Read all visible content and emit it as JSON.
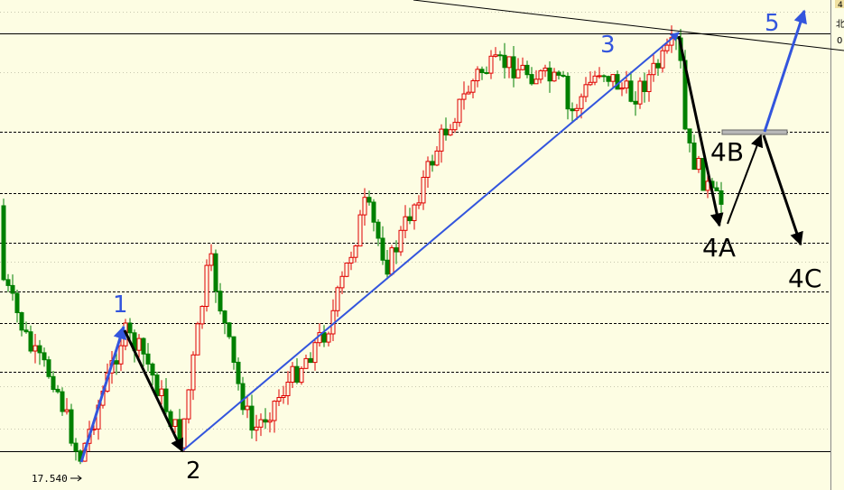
{
  "chart_data": {
    "type": "candlestick",
    "low_marker": {
      "label": "17.540",
      "value": 17.54
    },
    "right_axis_fragments": [
      "4",
      "北",
      "0"
    ],
    "colors": {
      "background": "#fdfde3",
      "up_candle": "#e00000",
      "down_candle": "#008000",
      "wave_impulse": "#3355dd",
      "wave_corrective": "#000000",
      "target_zone": "#999999"
    },
    "wave_labels": [
      {
        "text": "1",
        "color": "#3355dd"
      },
      {
        "text": "2",
        "color": "#000000"
      },
      {
        "text": "3",
        "color": "#3355dd"
      },
      {
        "text": "4A",
        "color": "#000000"
      },
      {
        "text": "4B",
        "color": "#000000"
      },
      {
        "text": "4C",
        "color": "#000000"
      },
      {
        "text": "5",
        "color": "#3355dd"
      }
    ]
  }
}
